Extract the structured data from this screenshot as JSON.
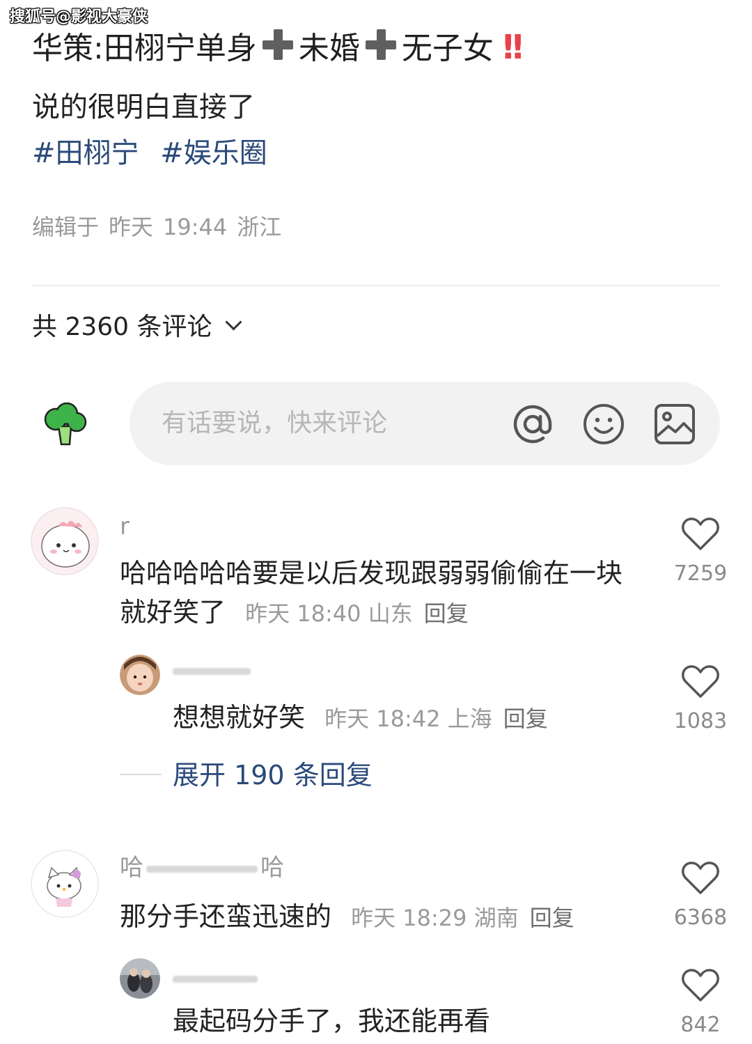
{
  "watermark": "搜狐号@影视大豪侠",
  "post": {
    "title_part1": "华策:田栩宁单身",
    "title_part2": "未婚",
    "title_part3": "无子女",
    "title_bang": "!!",
    "body": "说的很明白直接了",
    "hashtags": [
      "#田栩宁",
      "#娱乐圈"
    ],
    "meta": {
      "label": "编辑于",
      "day": "昨天",
      "time": "19:44",
      "location": "浙江"
    }
  },
  "comments_header": {
    "count_text": "共 2360 条评论"
  },
  "comment_input": {
    "placeholder": "有话要说，快来评论",
    "icons": [
      "at-icon",
      "emoji-icon",
      "image-icon"
    ]
  },
  "comments": [
    {
      "username": "r",
      "text": "哈哈哈哈哈要是以后发现跟弱弱偷偷在一块就好笑了",
      "time": "昨天 18:40",
      "location": "山东",
      "reply_label": "回复",
      "likes": "7259",
      "replies": [
        {
          "username": "",
          "text": "想想就好笑",
          "time": "昨天 18:42",
          "location": "上海",
          "reply_label": "回复",
          "likes": "1083"
        }
      ],
      "expand_label": "展开 190 条回复"
    },
    {
      "username": "哈",
      "username_tail": "哈",
      "text": "那分手还蛮迅速的",
      "time": "昨天 18:29",
      "location": "湖南",
      "reply_label": "回复",
      "likes": "6368",
      "replies": [
        {
          "username": "",
          "text": "最起码分手了，我还能再看",
          "likes": "842"
        }
      ]
    }
  ],
  "colors": {
    "hashtag": "#2b4a7a",
    "meta_gray": "#9a9a9a",
    "input_bg": "#f2f2f2",
    "bang_red": "#e8414c",
    "broccoli_green": "#3eb34a"
  }
}
